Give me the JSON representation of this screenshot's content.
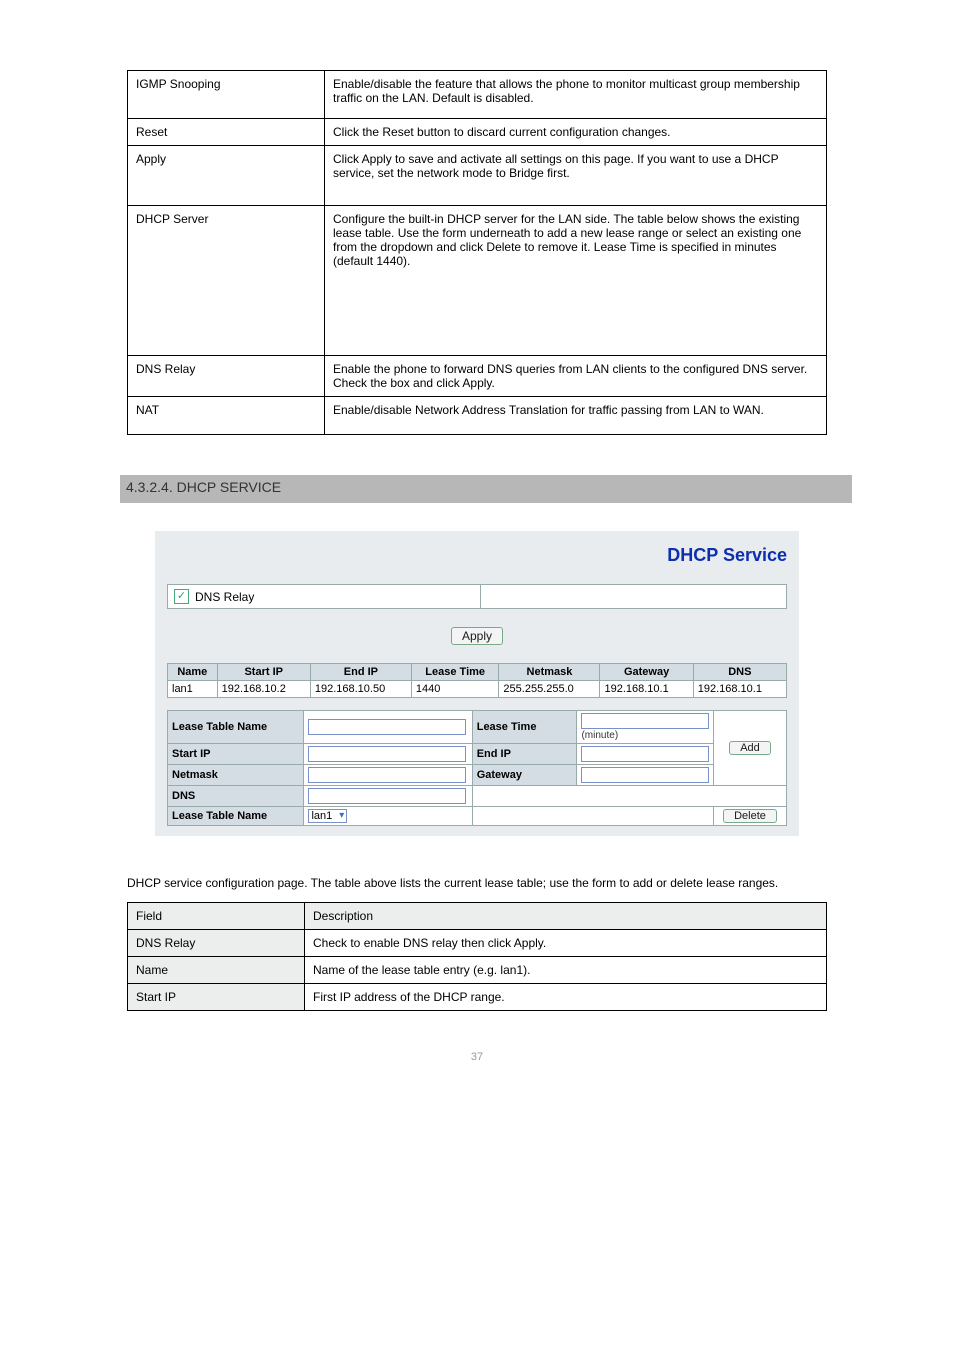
{
  "top_table": {
    "rows": [
      {
        "c1": "IGMP Snooping",
        "c2": "Enable/disable the feature that allows the phone to monitor multicast group membership traffic on the LAN. Default is disabled."
      },
      {
        "c1": "Reset",
        "c2": "Click the Reset button to discard current configuration changes."
      },
      {
        "c1": "Apply",
        "c2": "Click Apply to save and activate all settings on this page. If you want to use a DHCP service, set the network mode to Bridge first."
      },
      {
        "c1": "DHCP Server",
        "c2": "Configure the built-in DHCP server for the LAN side. The table below shows the existing lease table. Use the form underneath to add a new lease range or select an existing one from the dropdown and click Delete to remove it. Lease Time is specified in minutes (default 1440)."
      },
      {
        "c1": "DNS Relay",
        "c2": "Enable the phone to forward DNS queries from LAN clients to the configured DNS server. Check the box and click Apply."
      },
      {
        "c1": "NAT",
        "c2": "Enable/disable Network Address Translation for traffic passing from LAN to WAN."
      }
    ]
  },
  "section_bar": "4.3.2.4. DHCP SERVICE",
  "panel": {
    "title": "DHCP Service",
    "dns_relay_label": "DNS Relay",
    "dns_relay_checked": true,
    "apply_label": "Apply",
    "lease_headers": [
      "Name",
      "Start IP",
      "End IP",
      "Lease Time",
      "Netmask",
      "Gateway",
      "DNS"
    ],
    "lease_rows": [
      {
        "name": "lan1",
        "start": "192.168.10.2",
        "end": "192.168.10.50",
        "lease": "1440",
        "mask": "255.255.255.0",
        "gw": "192.168.10.1",
        "dns": "192.168.10.1"
      }
    ],
    "form": {
      "lease_table_name": "Lease Table Name",
      "lease_time": "Lease Time",
      "minute": "(minute)",
      "start_ip": "Start IP",
      "end_ip": "End IP",
      "netmask": "Netmask",
      "gateway": "Gateway",
      "dns": "DNS",
      "add": "Add",
      "delete": "Delete",
      "select_value": "lan1"
    }
  },
  "caption_text": "DHCP service configuration page. The table above lists the current lease table; use the form to add or delete lease ranges.",
  "desc_table": {
    "header": [
      "Field",
      "Description"
    ],
    "rows": [
      [
        "DNS Relay",
        "Check to enable DNS relay then click Apply."
      ],
      [
        "Name",
        "Name of the lease table entry (e.g. lan1)."
      ],
      [
        "Start IP",
        "First IP address of the DHCP range."
      ]
    ]
  },
  "page_number": "37"
}
